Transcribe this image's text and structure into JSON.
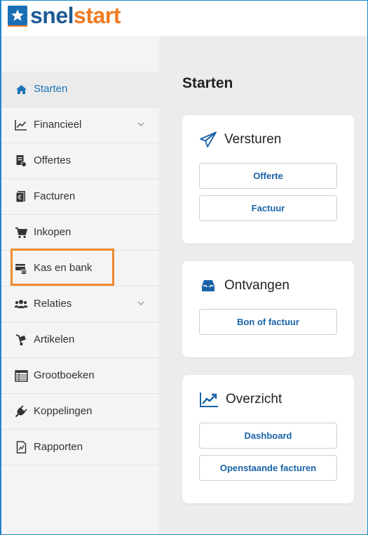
{
  "brand": {
    "name_part1": "snel",
    "name_part2": "start",
    "color_primary": "#1c5a94",
    "color_accent": "#f07a22"
  },
  "sidebar": {
    "items": [
      {
        "label": "Starten",
        "icon": "home-icon",
        "active": true,
        "expandable": false
      },
      {
        "label": "Financieel",
        "icon": "line-chart-icon",
        "active": false,
        "expandable": true
      },
      {
        "label": "Offertes",
        "icon": "quote-document-icon",
        "active": false,
        "expandable": false
      },
      {
        "label": "Facturen",
        "icon": "invoice-euro-icon",
        "active": false,
        "expandable": false
      },
      {
        "label": "Inkopen",
        "icon": "shopping-cart-icon",
        "active": false,
        "expandable": false
      },
      {
        "label": "Kas en bank",
        "icon": "cash-bank-icon",
        "active": false,
        "expandable": false,
        "highlighted": true
      },
      {
        "label": "Relaties",
        "icon": "users-icon",
        "active": false,
        "expandable": true
      },
      {
        "label": "Artikelen",
        "icon": "hand-truck-icon",
        "active": false,
        "expandable": false
      },
      {
        "label": "Grootboeken",
        "icon": "ledger-icon",
        "active": false,
        "expandable": false
      },
      {
        "label": "Koppelingen",
        "icon": "plug-icon",
        "active": false,
        "expandable": false
      },
      {
        "label": "Rapporten",
        "icon": "report-icon",
        "active": false,
        "expandable": false
      }
    ],
    "highlight_color": "#f08a2c"
  },
  "main": {
    "title": "Starten",
    "cards": [
      {
        "title": "Versturen",
        "icon": "send-icon",
        "buttons": [
          "Offerte",
          "Factuur"
        ]
      },
      {
        "title": "Ontvangen",
        "icon": "inbox-icon",
        "buttons": [
          "Bon of factuur"
        ]
      },
      {
        "title": "Overzicht",
        "icon": "trend-chart-icon",
        "buttons": [
          "Dashboard",
          "Openstaande facturen"
        ]
      }
    ]
  }
}
